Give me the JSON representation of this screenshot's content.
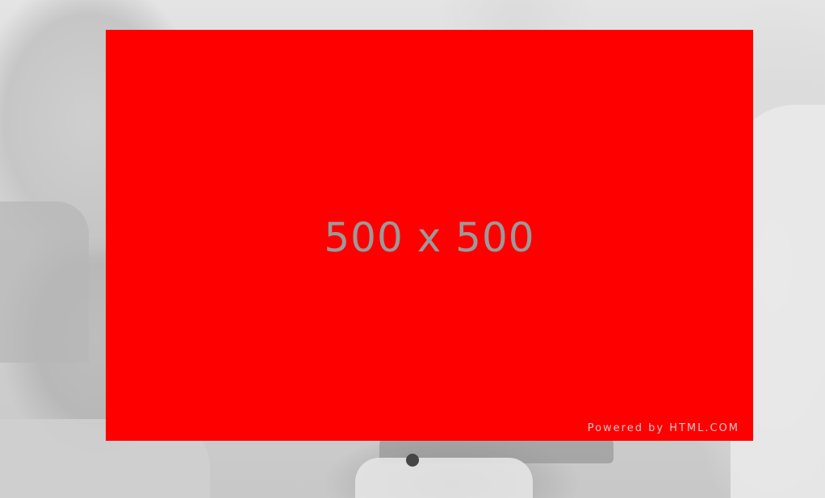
{
  "slider": {
    "active_index": 0,
    "slides": [
      {
        "placeholder_text": "500 x 500",
        "credit_text": "Powered by HTML.COM",
        "background_color": "#ff0000"
      }
    ],
    "pagination": {
      "dot_count": 1,
      "active_dot_color": "#464646"
    }
  }
}
